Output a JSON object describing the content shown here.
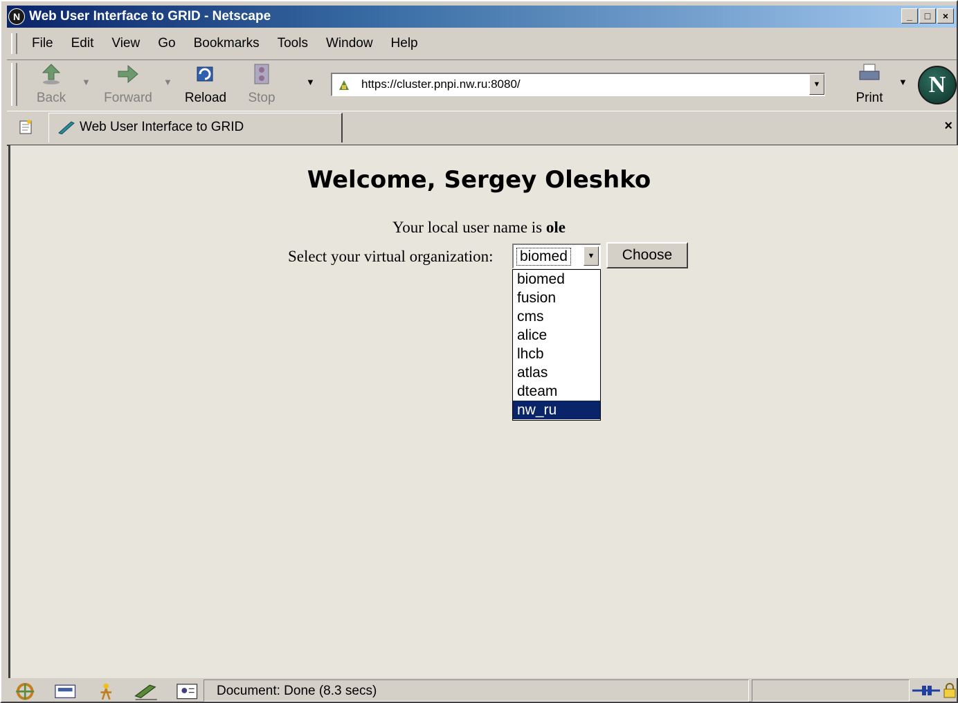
{
  "window": {
    "title": "Web User Interface to GRID - Netscape",
    "buttons": [
      "_",
      "□",
      "×"
    ]
  },
  "menu": [
    "File",
    "Edit",
    "View",
    "Go",
    "Bookmarks",
    "Tools",
    "Window",
    "Help"
  ],
  "toolbar": {
    "back": "Back",
    "forward": "Forward",
    "reload": "Reload",
    "stop": "Stop",
    "print": "Print",
    "url": "https://cluster.pnpi.nw.ru:8080/",
    "logo": "N"
  },
  "tab": {
    "title": "Web User Interface to GRID",
    "close": "×"
  },
  "page": {
    "heading": "Welcome, Sergey Oleshko",
    "local_user_prefix": "Your local user name is ",
    "local_user_name": "ole",
    "vo_label": "Select your virtual organization:",
    "vo_selected": "biomed",
    "choose_label": "Choose",
    "vo_options": [
      "biomed",
      "fusion",
      "cms",
      "alice",
      "lhcb",
      "atlas",
      "dteam",
      "nw_ru"
    ],
    "vo_highlighted": "nw_ru"
  },
  "status": {
    "text": "Document: Done (8.3 secs)"
  },
  "colors": {
    "highlight": "#0a246a",
    "content_bg": "#e8e6dc",
    "chrome": "#d4d0c8"
  }
}
